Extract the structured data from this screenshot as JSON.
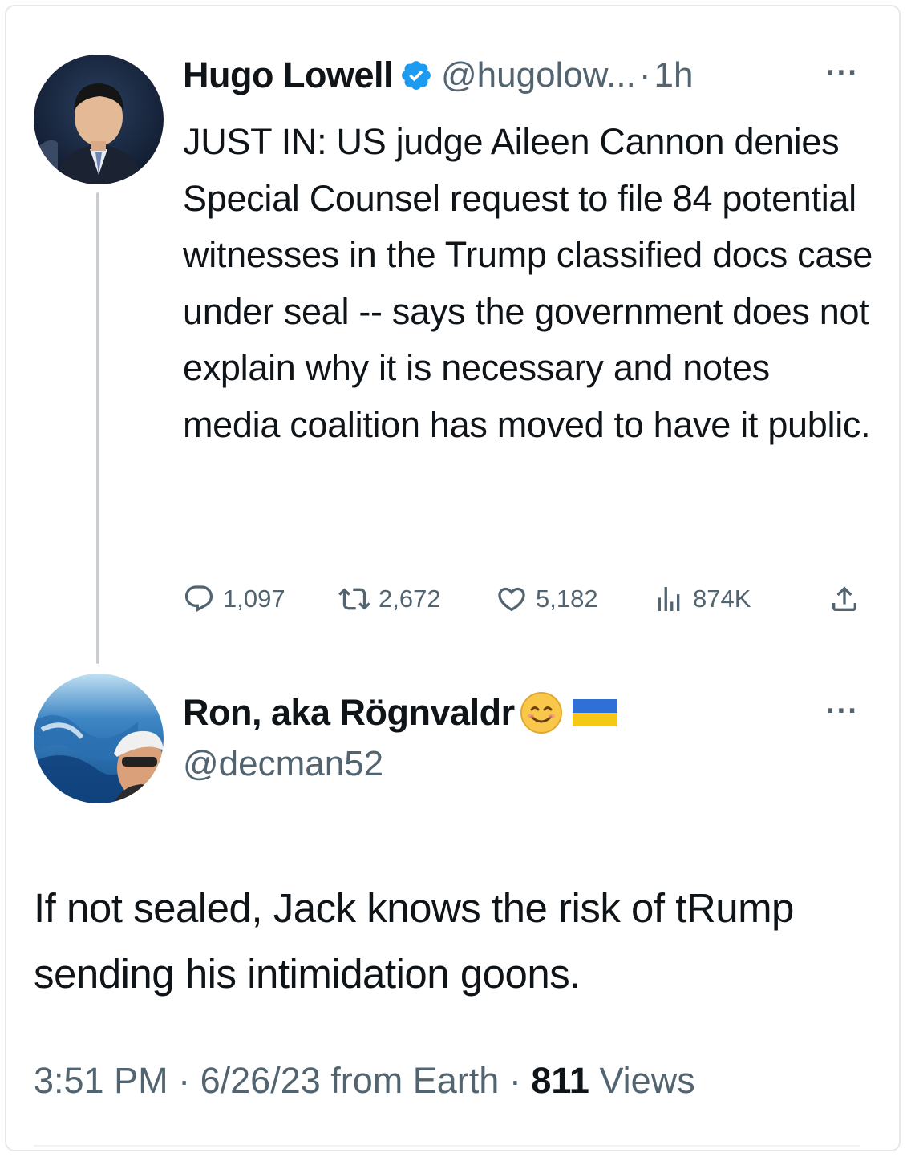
{
  "original_tweet": {
    "author_name": "Hugo Lowell",
    "verified": true,
    "handle": "@hugolow...",
    "separator": "·",
    "time": "1h",
    "more": "···",
    "text": "JUST IN: US judge Aileen Cannon denies Special Counsel request to file 84 potential witnesses in the Trump classified docs case under seal -- says the government does not explain why it is necessary and notes media coalition has moved to have it public.",
    "metrics": {
      "replies": "1,097",
      "retweets": "2,672",
      "likes": "5,182",
      "views": "874K"
    }
  },
  "reply_tweet": {
    "author_name": "Ron, aka Rögnvaldr",
    "name_emoji": "smiling-face-emoji",
    "flag": "ukraine-flag",
    "handle": "@decman52",
    "more": "···",
    "text": "If not sealed, Jack knows the risk of tRump sending his intimidation goons.",
    "meta": {
      "time": "3:51 PM",
      "sep1": "·",
      "date_source": "6/26/23 from Earth",
      "sep2": "·",
      "view_count": "811",
      "views_label": "Views"
    }
  },
  "colors": {
    "text": "#0f1419",
    "secondary": "#536471",
    "verified_badge": "#1d9bf0",
    "thread_line": "#c9ccd0"
  }
}
